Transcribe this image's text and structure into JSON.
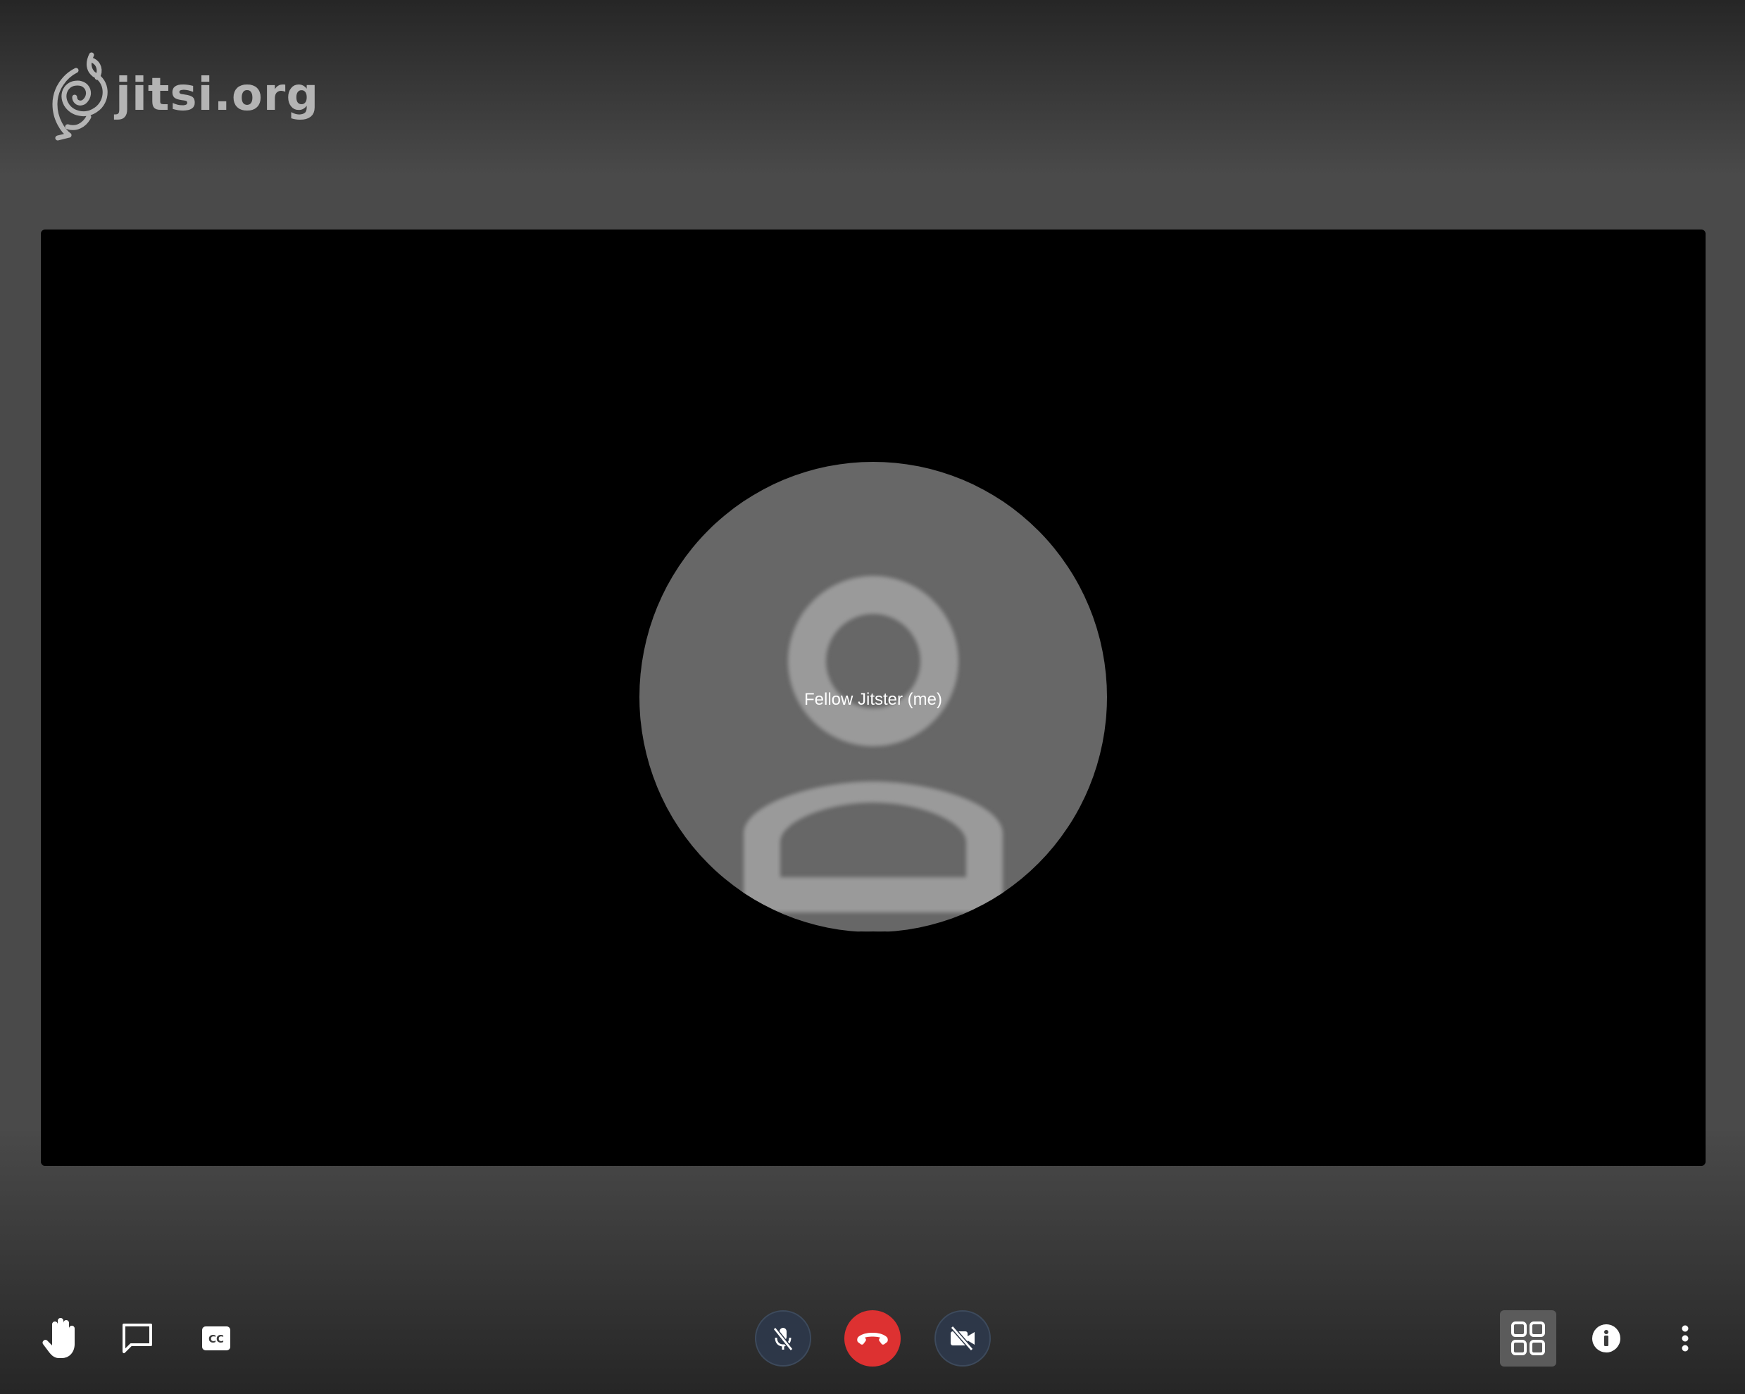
{
  "brand": {
    "logo_text": "jitsi.org",
    "logo_icon": "jitsi-logo-icon"
  },
  "stage": {
    "participant_name": "Fellow Jitster (me)",
    "avatar_icon": "user-avatar-icon"
  },
  "toolbar": {
    "left": [
      {
        "icon": "raise-hand-icon",
        "label": "Raise hand"
      },
      {
        "icon": "chat-icon",
        "label": "Chat"
      },
      {
        "icon": "closed-captions-icon",
        "label": "Subtitles"
      }
    ],
    "center": [
      {
        "icon": "microphone-muted-icon",
        "label": "Unmute microphone"
      },
      {
        "icon": "hangup-icon",
        "label": "Leave meeting"
      },
      {
        "icon": "camera-off-icon",
        "label": "Start camera"
      }
    ],
    "right": [
      {
        "icon": "tile-view-icon",
        "label": "Tile view",
        "active": true
      },
      {
        "icon": "info-icon",
        "label": "Meeting info"
      },
      {
        "icon": "more-options-icon",
        "label": "More actions"
      }
    ]
  },
  "colors": {
    "hangup": "#dd3131",
    "media_button": "#2d3748",
    "avatar": "#676767",
    "avatar_glyph": "#9a9a9a",
    "logo": "#b4b4b4"
  }
}
